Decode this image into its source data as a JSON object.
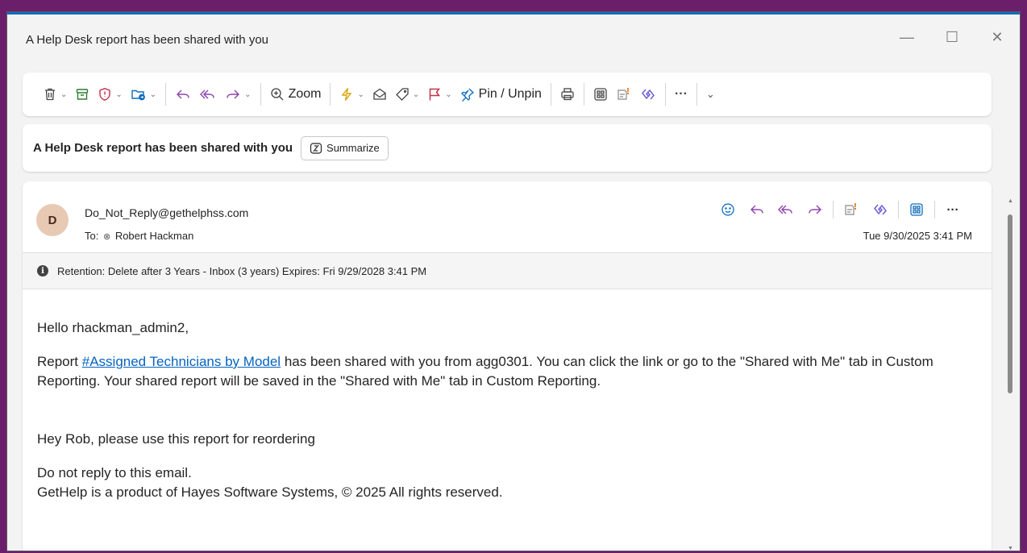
{
  "window": {
    "title": "A Help Desk report has been shared with you",
    "minimize_glyph": "—",
    "maximize_glyph": "☐",
    "close_glyph": "✕"
  },
  "toolbar": {
    "zoom_label": "Zoom",
    "pin_label": "Pin / Unpin",
    "more_glyph": "···",
    "expand_glyph": "⌄",
    "icons": [
      "delete-icon",
      "archive-icon",
      "report-icon",
      "move-icon",
      "reply-icon",
      "reply-all-icon",
      "forward-icon",
      "zoom-icon",
      "quick-steps-icon",
      "mark-read-icon",
      "tag-icon",
      "flag-icon",
      "pin-icon",
      "print-icon",
      "apps-icon",
      "viva-icon",
      "loop-icon",
      "more-icon"
    ]
  },
  "subject_bar": {
    "subject": "A Help Desk report has been shared with you",
    "summarize_label": "Summarize"
  },
  "message": {
    "avatar_initial": "D",
    "from": "Do_Not_Reply@gethelphss.com",
    "to_prefix": "To:",
    "to_name": "Robert Hackman",
    "date": "Tue 9/30/2025 3:41 PM",
    "retention": "Retention: Delete after 3 Years - Inbox (3 years) Expires: Fri 9/29/2028 3:41 PM",
    "greeting": "Hello rhackman_admin2,",
    "report_prefix": "Report ",
    "report_link": "#Assigned Technicians by Model",
    "report_suffix": " has been shared with you from agg0301. You can click the link or go to the \"Shared with Me\" tab in Custom Reporting. Your shared report will be saved in the \"Shared with Me\" tab in Custom Reporting.",
    "note": "Hey Rob, please use this report for reordering",
    "noreply": "Do not reply to this email.",
    "footer": "GetHelp is a product of Hayes Software Systems, © 2025 All rights reserved."
  },
  "colors": {
    "accent": "#0f6cbd",
    "link": "#0563c1",
    "flag": "#c4314b",
    "frame": "#6b1f6b"
  }
}
